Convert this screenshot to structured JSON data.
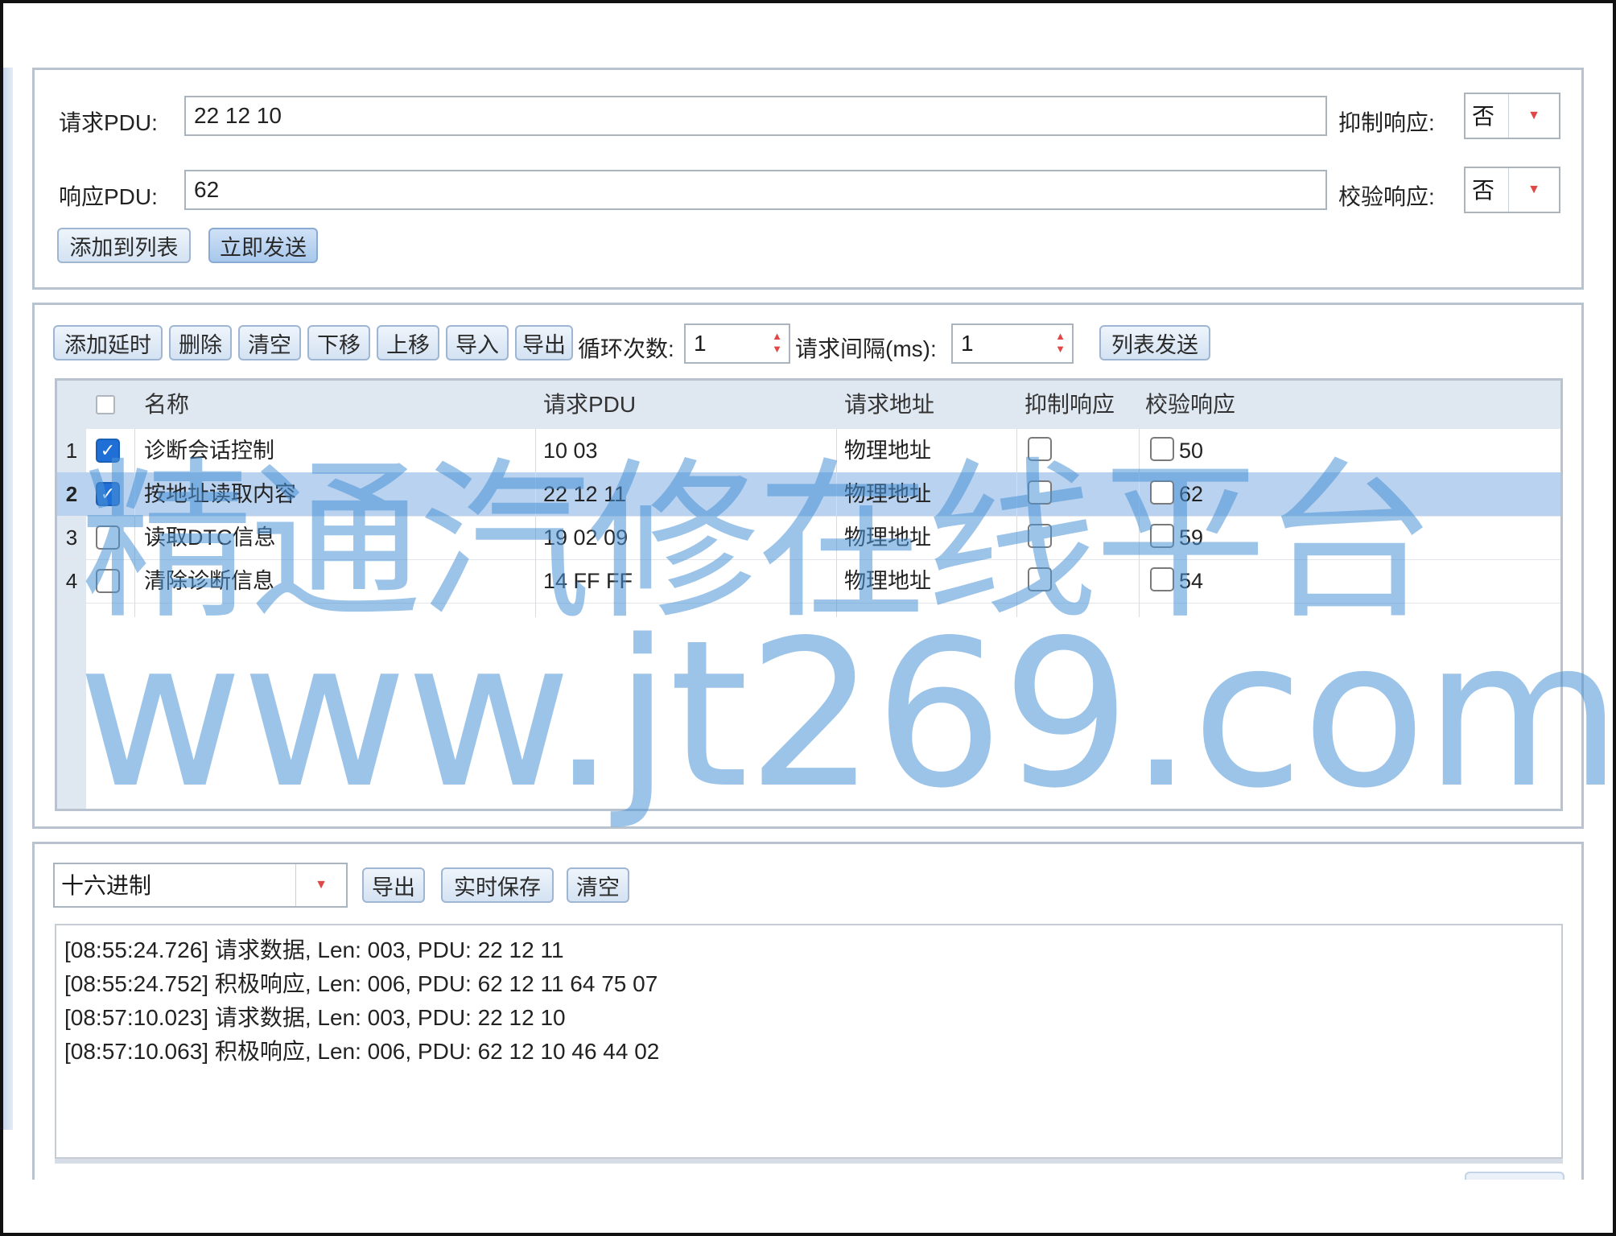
{
  "request_section": {
    "request_label": "请求PDU:",
    "request_value": "22 12 10",
    "response_label": "响应PDU:",
    "response_value": "62",
    "suppress_label": "抑制响应:",
    "suppress_value": "否",
    "verify_label": "校验响应:",
    "verify_value": "否",
    "add_to_list_label": "添加到列表",
    "send_now_label": "立即发送"
  },
  "list_section": {
    "toolbar": {
      "add_delay": "添加延时",
      "delete": "删除",
      "clear": "清空",
      "move_down": "下移",
      "move_up": "上移",
      "import": "导入",
      "export": "导出",
      "loop_label": "循环次数:",
      "loop_value": "1",
      "interval_label": "请求间隔(ms):",
      "interval_value": "1",
      "list_send": "列表发送"
    },
    "columns": {
      "name": "名称",
      "request_pdu": "请求PDU",
      "request_address": "请求地址",
      "suppress": "抑制响应",
      "verify": "校验响应"
    },
    "rows": [
      {
        "index": "1",
        "checked": true,
        "name": "诊断会话控制",
        "pdu": "10 03",
        "address": "物理地址",
        "suppress": false,
        "verify": false,
        "verify_value": "50"
      },
      {
        "index": "2",
        "checked": true,
        "name": "按地址读取内容",
        "pdu": "22 12 11",
        "address": "物理地址",
        "suppress": false,
        "verify": false,
        "verify_value": "62"
      },
      {
        "index": "3",
        "checked": false,
        "name": "读取DTC信息",
        "pdu": "19 02 09",
        "address": "物理地址",
        "suppress": false,
        "verify": false,
        "verify_value": "59"
      },
      {
        "index": "4",
        "checked": false,
        "name": "清除诊断信息",
        "pdu": "14 FF FF",
        "address": "物理地址",
        "suppress": false,
        "verify": false,
        "verify_value": "54"
      }
    ]
  },
  "log_section": {
    "format_value": "十六进制",
    "export": "导出",
    "realtime_save": "实时保存",
    "clear": "清空",
    "lines": [
      "[08:55:24.726] 请求数据, Len: 003, PDU: 22 12 11",
      "[08:55:24.752] 积极响应, Len: 006, PDU: 62 12 11 64 75 07",
      "[08:57:10.023] 请求数据, Len: 003, PDU: 22 12 10",
      "[08:57:10.063] 积极响应, Len: 006, PDU: 62 12 10 46 44 02"
    ]
  },
  "watermark": {
    "line1": "精通汽修在线平台",
    "line2": "www.jt269.com"
  },
  "colors": {
    "accent": "#1f6fd6",
    "selected_row": "#b9d2ef",
    "watermark": "#4a92d6",
    "dropdown_arrow": "#e04848"
  }
}
